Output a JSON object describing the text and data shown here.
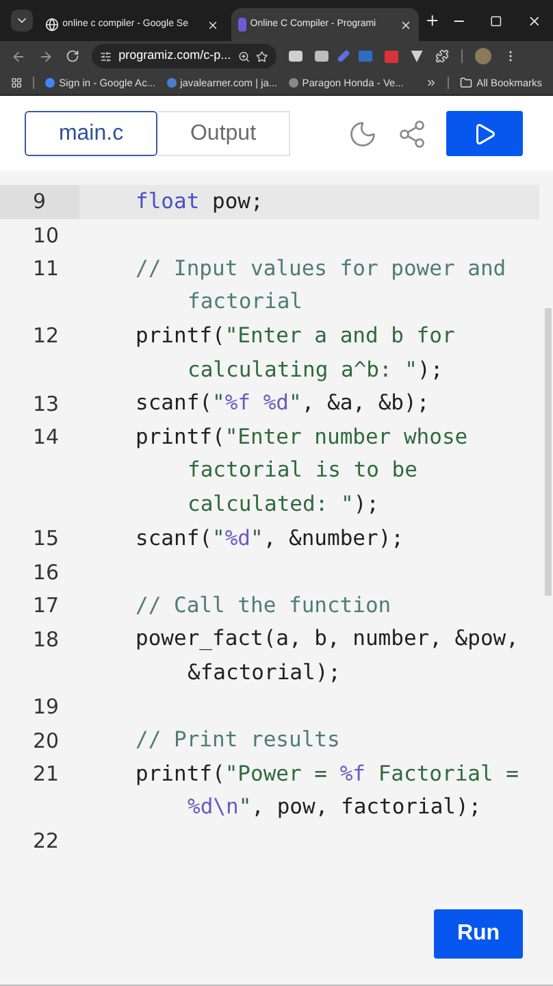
{
  "browser": {
    "tabs": [
      {
        "title": "online c compiler - Google Se",
        "selected": false
      },
      {
        "title": "Online C Compiler - Programi",
        "selected": true
      }
    ],
    "address": "programiz.com/c-p...",
    "bookmarks": [
      "Sign in - Google Ac...",
      "javalearner.com | ja...",
      "Paragon Honda - Ve..."
    ],
    "all_bookmarks": "All Bookmarks"
  },
  "editor": {
    "tabs": [
      {
        "label": "main.c",
        "selected": true
      },
      {
        "label": "Output",
        "selected": false
      }
    ],
    "lines": [
      {
        "number": "9",
        "highlighted": true,
        "rows": [
          [
            {
              "kind": "keyword",
              "text": "float"
            },
            {
              "kind": "plain",
              "text": " pow;"
            }
          ]
        ]
      },
      {
        "number": "10",
        "highlighted": false
      },
      {
        "number": "11",
        "highlighted": false,
        "rows": [
          [
            {
              "kind": "comment",
              "text": "// Input values for power and"
            }
          ],
          [
            {
              "kind": "comment",
              "text": "factorial"
            }
          ]
        ]
      },
      {
        "number": "12",
        "highlighted": false,
        "rows": [
          [
            {
              "kind": "plain",
              "text": "printf("
            },
            {
              "kind": "string",
              "text": "\"Enter a and b for"
            }
          ],
          [
            {
              "kind": "string",
              "text": "calculating a^b: \""
            },
            {
              "kind": "plain",
              "text": ");"
            }
          ]
        ]
      },
      {
        "number": "13",
        "highlighted": false,
        "rows": [
          [
            {
              "kind": "plain",
              "text": "scanf("
            },
            {
              "kind": "string",
              "text": "\""
            },
            {
              "kind": "format",
              "text": "%f %d"
            },
            {
              "kind": "string",
              "text": "\""
            },
            {
              "kind": "plain",
              "text": ", &a, &b);"
            }
          ]
        ]
      },
      {
        "number": "14",
        "highlighted": false,
        "rows": [
          [
            {
              "kind": "plain",
              "text": "printf("
            },
            {
              "kind": "string",
              "text": "\"Enter number whose"
            }
          ],
          [
            {
              "kind": "string",
              "text": "factorial is to be"
            }
          ],
          [
            {
              "kind": "string",
              "text": "calculated: \""
            },
            {
              "kind": "plain",
              "text": ");"
            }
          ]
        ]
      },
      {
        "number": "15",
        "highlighted": false,
        "rows": [
          [
            {
              "kind": "plain",
              "text": "scanf("
            },
            {
              "kind": "string",
              "text": "\""
            },
            {
              "kind": "format",
              "text": "%d"
            },
            {
              "kind": "string",
              "text": "\""
            },
            {
              "kind": "plain",
              "text": ", &number);"
            }
          ]
        ]
      },
      {
        "number": "16",
        "highlighted": false
      },
      {
        "number": "17",
        "highlighted": false,
        "rows": [
          [
            {
              "kind": "comment",
              "text": "// Call the function"
            }
          ]
        ]
      },
      {
        "number": "18",
        "highlighted": false,
        "rows": [
          [
            {
              "kind": "plain",
              "text": "power_fact(a, b, number, &pow,"
            }
          ],
          [
            {
              "kind": "plain",
              "text": "&factorial);"
            }
          ]
        ]
      },
      {
        "number": "19",
        "highlighted": false
      },
      {
        "number": "20",
        "highlighted": false,
        "rows": [
          [
            {
              "kind": "comment",
              "text": "// Print results"
            }
          ]
        ]
      },
      {
        "number": "21",
        "highlighted": false,
        "rows": [
          [
            {
              "kind": "plain",
              "text": "printf("
            },
            {
              "kind": "string",
              "text": "\"Power = "
            },
            {
              "kind": "format",
              "text": "%f"
            },
            {
              "kind": "string",
              "text": " Factorial ="
            }
          ],
          [
            {
              "kind": "format",
              "text": "%d\\n"
            },
            {
              "kind": "string",
              "text": "\""
            },
            {
              "kind": "plain",
              "text": ", pow, factorial);"
            }
          ]
        ]
      },
      {
        "number": "22",
        "highlighted": false
      }
    ],
    "run_button": "Run"
  }
}
